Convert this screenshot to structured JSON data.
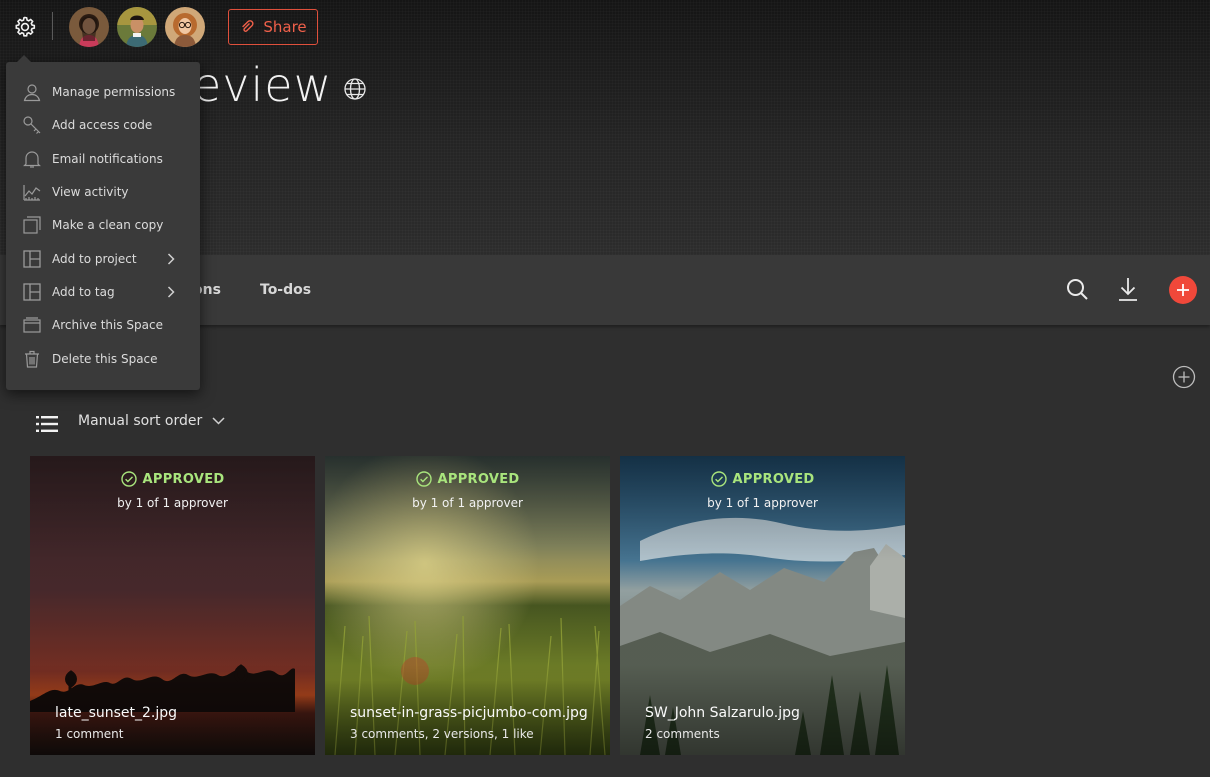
{
  "header": {
    "title_visible": "eview",
    "share_label": "Share",
    "avatars": [
      "avatar-1",
      "avatar-2",
      "avatar-3"
    ]
  },
  "tabs": {
    "clipped_label": "ons",
    "todos_label": "To-dos"
  },
  "menu": {
    "items": [
      {
        "label": "Manage permissions",
        "icon": "person-icon"
      },
      {
        "label": "Add access code",
        "icon": "key-icon"
      },
      {
        "label": "Email notifications",
        "icon": "bell-icon"
      },
      {
        "label": "View activity",
        "icon": "activity-chart-icon"
      },
      {
        "label": "Make a clean copy",
        "icon": "copy-icon"
      },
      {
        "label": "Add to project",
        "icon": "layout-icon",
        "submenu": true
      },
      {
        "label": "Add to tag",
        "icon": "layout-icon",
        "submenu": true
      },
      {
        "label": "Archive this Space",
        "icon": "archive-icon"
      },
      {
        "label": "Delete this Space",
        "icon": "trash-icon"
      }
    ]
  },
  "toolbar": {
    "sort_label": "Manual sort order"
  },
  "cards": [
    {
      "status": "APPROVED",
      "approver_text": "by 1 of 1 approver",
      "filename": "late_sunset_2.jpg",
      "meta": "1 comment"
    },
    {
      "status": "APPROVED",
      "approver_text": "by 1 of 1 approver",
      "filename": "sunset-in-grass-picjumbo-com.jpg",
      "meta": "3 comments, 2 versions, 1 like"
    },
    {
      "status": "APPROVED",
      "approver_text": "by 1 of 1 approver",
      "filename": "SW_John Salzarulo.jpg",
      "meta": "2 comments"
    }
  ],
  "colors": {
    "accent": "#f0483a",
    "approved": "#a9e57d",
    "background": "#2f2f2f",
    "menu": "#3a3a3a"
  }
}
